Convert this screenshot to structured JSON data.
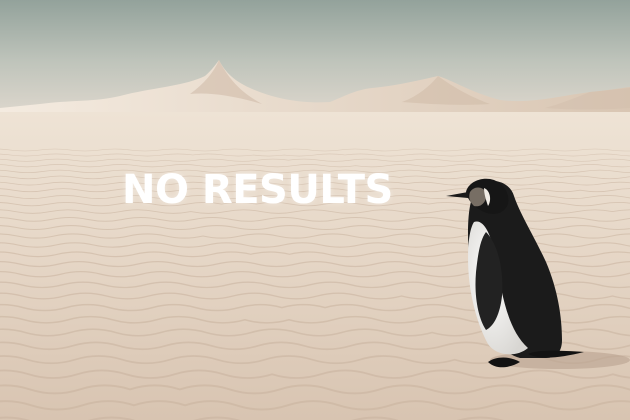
{
  "empty_state": {
    "message": "NO RESULTS"
  },
  "illustration": {
    "subject": "penguin-icon",
    "setting": "desert-dunes"
  },
  "colors": {
    "sky_top": "#9aa8a1",
    "sky_bottom": "#d6d4cc",
    "sand_light": "#efe3d4",
    "sand_mid": "#e3d3c2",
    "sand_dark": "#cbb7a3",
    "text": "#ffffff"
  }
}
